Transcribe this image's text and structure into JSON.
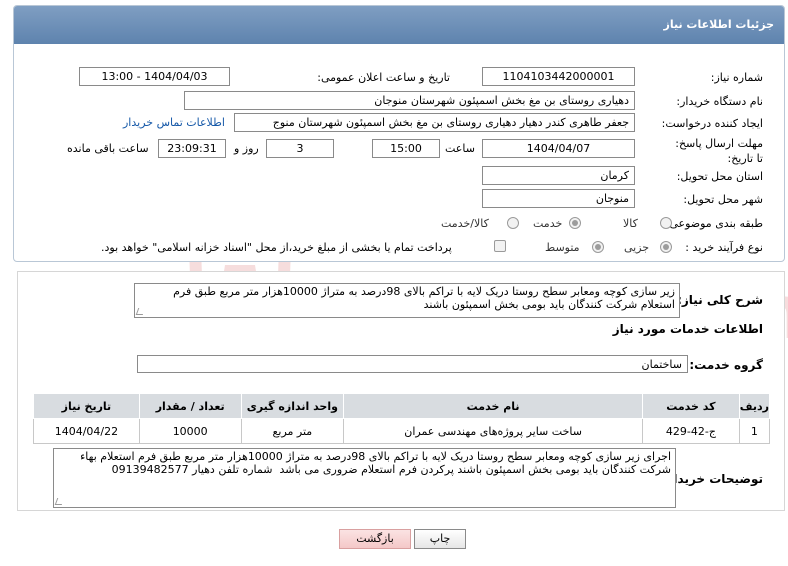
{
  "header": {
    "title": "جزئیات اطلاعات نیاز"
  },
  "fields": {
    "need_number_label": "شماره نیاز:",
    "need_number": "1104103442000001",
    "announce_label": "تاریخ و ساعت اعلان عمومی:",
    "announce_value": "1404/04/03 - 13:00",
    "buyer_org_label": "نام دستگاه خریدار:",
    "buyer_org": "دهیاری روستای بن مغ بخش اسمپئون شهرستان منوجان",
    "creator_label": "ایجاد کننده درخواست:",
    "creator": "جعفر طاهری کندر دهیار  دهیاری روستای بن مغ بخش اسمپئون شهرستان منوج",
    "contact_link": "اطلاعات تماس خریدار",
    "deadline_label": "مهلت ارسال پاسخ: تا تاریخ:",
    "deadline_date": "1404/04/07",
    "time_label": "ساعت",
    "deadline_time": "15:00",
    "days_value": "3",
    "days_label": "روز و",
    "remaining_time": "23:09:31",
    "remaining_label": "ساعت باقی مانده",
    "province_label": "استان محل تحویل:",
    "province": "کرمان",
    "city_label": "شهر محل تحویل:",
    "city": "منوجان",
    "category_label": "طبقه بندی موضوعی:",
    "category_options": [
      "کالا",
      "خدمت",
      "کالا/خدمت"
    ],
    "category_selected": "خدمت",
    "process_label": "نوع فرآیند خرید :",
    "process_options": [
      "جزیی",
      "متوسط"
    ],
    "process_selected": "جزیی",
    "payment_note": "پرداخت تمام یا بخشی از مبلغ خرید،از محل \"اسناد خزانه اسلامی\" خواهد بود."
  },
  "summary": {
    "label": "شرح کلی نیاز:",
    "text": "زیر سازی کوچه ومعابر سطح روستا دریک لایه با تراکم بالای 98درصد به متراژ 10000هزار متر مربع طبق فرم استعلام شرکت کنندگان باید بومی بخش اسمپئون باشند"
  },
  "services": {
    "section_title": "اطلاعات خدمات مورد نیاز",
    "group_label": "گروه خدمت:",
    "group_value": "ساختمان",
    "columns": [
      "ردیف",
      "کد خدمت",
      "نام خدمت",
      "واحد اندازه گیری",
      "تعداد / مقدار",
      "تاریخ نیاز"
    ],
    "rows": [
      [
        "1",
        "ج-42-429",
        "ساخت سایر پروژه‌های مهندسی عمران",
        "متر مربع",
        "10000",
        "1404/04/22"
      ]
    ]
  },
  "buyer_notes": {
    "label": "توضیحات خریدار:",
    "text": "اجرای زیر سازی کوچه ومعابر سطح روستا دریک لایه با تراکم بالای 98درصد به متراژ 10000هزار متر مربع طبق فرم استعلام بهاء شرکت کنندگان باید بومی بخش اسمپئون باشند پرکردن فرم استعلام ضروری می باشد  شماره تلفن دهیار 09139482577"
  },
  "buttons": {
    "print": "چاپ",
    "back": "بازگشت"
  },
  "watermark": {
    "text": "AriaTender.net",
    "icon": "shield-logo"
  },
  "colors": {
    "header": "#6a8cb6",
    "link": "#1558a8",
    "back_button": "#f4c8c8",
    "watermark": "#c00000"
  }
}
